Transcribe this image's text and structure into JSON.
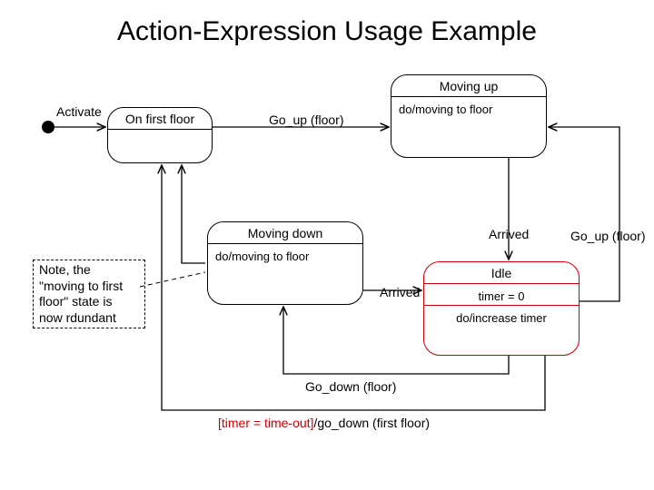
{
  "title": "Action-Expression Usage Example",
  "states": {
    "on_first_floor": {
      "title": "On first floor"
    },
    "moving_up": {
      "title": "Moving up",
      "body": "do/moving to floor"
    },
    "moving_down": {
      "title": "Moving down",
      "body": "do/moving to floor"
    },
    "idle": {
      "title": "Idle",
      "body1": "timer = 0",
      "body2": "do/increase timer"
    }
  },
  "labels": {
    "activate": "Activate",
    "go_up1": "Go_up (floor)",
    "go_up2": "Go_up (floor)",
    "arrived1": "Arrived",
    "arrived2": "Arrived",
    "go_down": "Go_down (floor)"
  },
  "timeout": {
    "guard": "[timer = time-out]",
    "slash": "/",
    "action": "go_down (first floor)"
  },
  "note": "Note, the \"moving to first floor\" state is now rdundant"
}
